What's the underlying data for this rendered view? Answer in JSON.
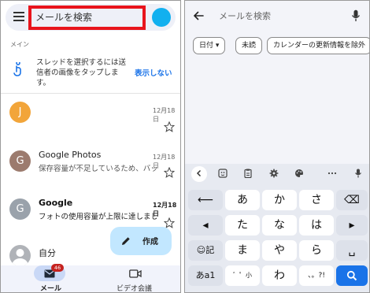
{
  "left": {
    "search_placeholder": "メールを検索",
    "section_label": "メイン",
    "hint": {
      "text": "スレッドを選択するには送信者の画像をタップします。",
      "dismiss": "表示しない"
    },
    "emails": [
      {
        "avatar_letter": "J",
        "avatar_color": "#f2a53a",
        "sender": "",
        "snippet": "",
        "date": "12月18日",
        "unread": false
      },
      {
        "avatar_letter": "G",
        "avatar_color": "#9c7b6e",
        "sender": "Google Photos",
        "snippet": "保存容量が不足しているため、バッ...",
        "date": "12月18日",
        "unread": false
      },
      {
        "avatar_letter": "G",
        "avatar_color": "#9aa2ab",
        "sender": "Google",
        "snippet": "フォトの使用容量が上限に達しました",
        "date": "12月18日",
        "unread": true
      },
      {
        "avatar_letter": "",
        "avatar_color": "#b0b3b8",
        "sender": "自分",
        "snippet": "",
        "date": "",
        "unread": false
      }
    ],
    "compose_label": "作成",
    "nav": {
      "mail_label": "メール",
      "mail_badge": "46",
      "video_label": "ビデオ会議"
    }
  },
  "right": {
    "search_placeholder": "メールを検索",
    "chips": [
      {
        "label": "日付 ▾"
      },
      {
        "label": "未読"
      },
      {
        "label": "カレンダーの更新情報を除外"
      }
    ],
    "keyboard": {
      "rows": [
        [
          "⟵",
          "あ",
          "か",
          "さ",
          "⌫"
        ],
        [
          "◂",
          "た",
          "な",
          "は",
          "▸"
        ],
        [
          "☺記",
          "ま",
          "や",
          "ら",
          "␣"
        ],
        [
          "あa1",
          "゛゜小",
          "わ",
          "、。?!",
          "search"
        ]
      ]
    },
    "accent": "#1a73e8"
  }
}
